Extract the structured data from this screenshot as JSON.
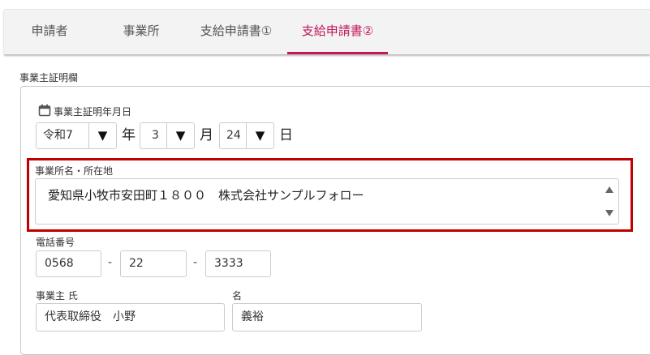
{
  "tabs": [
    {
      "label": "申請者"
    },
    {
      "label": "事業所"
    },
    {
      "label": "支給申請書①"
    },
    {
      "label": "支給申請書②",
      "active": true
    }
  ],
  "colors": {
    "accent": "#c2185b",
    "highlight": "#c00000"
  },
  "section": {
    "title": "事業主証明欄"
  },
  "cert_date": {
    "label": "事業主証明年月日",
    "icon": "calendar-icon",
    "era": "令和7",
    "year_unit": "年",
    "month": "3",
    "month_unit": "月",
    "day": "24",
    "day_unit": "日",
    "dropdown_glyph": "▼"
  },
  "office": {
    "label": "事業所名・所在地",
    "value": "愛知県小牧市安田町１８００　株式会社サンプルフォロー"
  },
  "phone": {
    "label": "電話番号",
    "part1": "0568",
    "part2": "22",
    "part3": "3333",
    "separator": "-"
  },
  "owner": {
    "last_label": "事業主 氏",
    "last_value": "代表取締役　小野",
    "first_label": "名",
    "first_value": "義裕"
  }
}
